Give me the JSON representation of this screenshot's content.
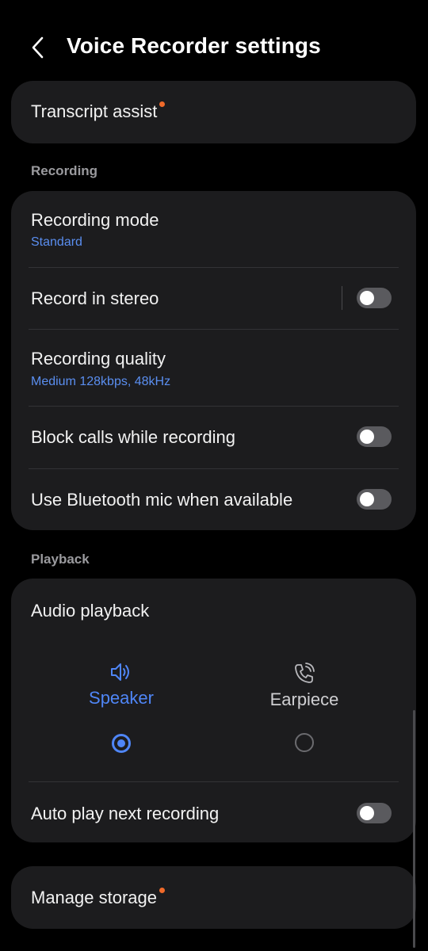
{
  "header": {
    "title": "Voice Recorder settings",
    "back_icon": "chevron-left-icon"
  },
  "transcript": {
    "label": "Transcript assist",
    "has_dot": true
  },
  "recording_section": {
    "label": "Recording",
    "items": [
      {
        "title": "Recording mode",
        "subtitle": "Standard"
      },
      {
        "title": "Record in stereo",
        "toggle": false
      },
      {
        "title": "Recording quality",
        "subtitle": "Medium 128kbps, 48kHz"
      },
      {
        "title": "Block calls while recording",
        "toggle": false
      },
      {
        "title": "Use Bluetooth mic when available",
        "toggle": false
      }
    ]
  },
  "playback_section": {
    "label": "Playback",
    "audio_playback": {
      "title": "Audio playback",
      "options": [
        {
          "label": "Speaker",
          "icon": "speaker-icon",
          "selected": true
        },
        {
          "label": "Earpiece",
          "icon": "phone-call-icon",
          "selected": false
        }
      ]
    },
    "auto_play": {
      "title": "Auto play next recording",
      "toggle": false
    }
  },
  "storage": {
    "label": "Manage storage",
    "has_dot": true
  },
  "colors": {
    "background": "#000000",
    "card": "#1c1c1e",
    "accent": "#4f86f7",
    "subtitle": "#5a8ef0",
    "badge_dot": "#f06a2a",
    "toggle_off": "#5a5a5e"
  }
}
